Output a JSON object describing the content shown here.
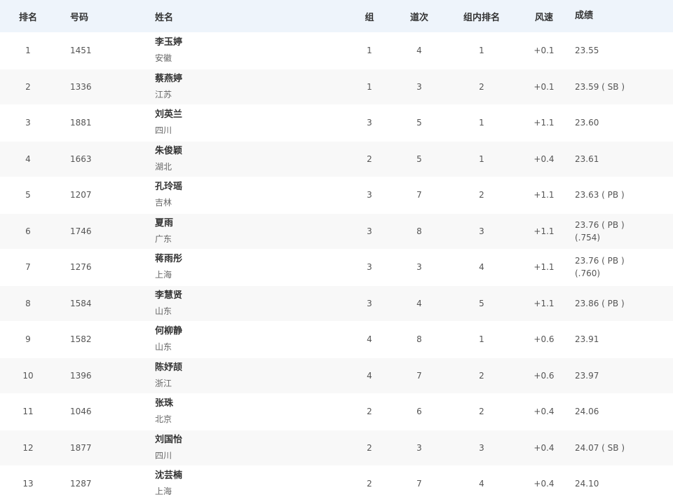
{
  "headers": {
    "rank": "排名",
    "bib": "号码",
    "name": "姓名",
    "group": "组",
    "lane": "道次",
    "group_rank": "组内排名",
    "wind": "风速",
    "result": "成绩"
  },
  "rows": [
    {
      "rank": "1",
      "bib": "1451",
      "name": "李玉婷",
      "team": "安徽",
      "group": "1",
      "lane": "4",
      "group_rank": "1",
      "wind": "+0.1",
      "result": "23.55",
      "note": ""
    },
    {
      "rank": "2",
      "bib": "1336",
      "name": "蔡燕婷",
      "team": "江苏",
      "group": "1",
      "lane": "3",
      "group_rank": "2",
      "wind": "+0.1",
      "result": "23.59 ( SB )",
      "note": ""
    },
    {
      "rank": "3",
      "bib": "1881",
      "name": "刘英兰",
      "team": "四川",
      "group": "3",
      "lane": "5",
      "group_rank": "1",
      "wind": "+1.1",
      "result": "23.60",
      "note": ""
    },
    {
      "rank": "4",
      "bib": "1663",
      "name": "朱俊颖",
      "team": "湖北",
      "group": "2",
      "lane": "5",
      "group_rank": "1",
      "wind": "+0.4",
      "result": "23.61",
      "note": ""
    },
    {
      "rank": "5",
      "bib": "1207",
      "name": "孔玲瑶",
      "team": "吉林",
      "group": "3",
      "lane": "7",
      "group_rank": "2",
      "wind": "+1.1",
      "result": "23.63 ( PB )",
      "note": ""
    },
    {
      "rank": "6",
      "bib": "1746",
      "name": "夏雨",
      "team": "广东",
      "group": "3",
      "lane": "8",
      "group_rank": "3",
      "wind": "+1.1",
      "result": "23.76 ( PB )",
      "note": "(.754)"
    },
    {
      "rank": "7",
      "bib": "1276",
      "name": "蒋雨彤",
      "team": "上海",
      "group": "3",
      "lane": "3",
      "group_rank": "4",
      "wind": "+1.1",
      "result": "23.76 ( PB )",
      "note": "(.760)"
    },
    {
      "rank": "8",
      "bib": "1584",
      "name": "李慧贤",
      "team": "山东",
      "group": "3",
      "lane": "4",
      "group_rank": "5",
      "wind": "+1.1",
      "result": "23.86 ( PB )",
      "note": ""
    },
    {
      "rank": "9",
      "bib": "1582",
      "name": "何柳静",
      "team": "山东",
      "group": "4",
      "lane": "8",
      "group_rank": "1",
      "wind": "+0.6",
      "result": "23.91",
      "note": ""
    },
    {
      "rank": "10",
      "bib": "1396",
      "name": "陈妤颉",
      "team": "浙江",
      "group": "4",
      "lane": "7",
      "group_rank": "2",
      "wind": "+0.6",
      "result": "23.97",
      "note": ""
    },
    {
      "rank": "11",
      "bib": "1046",
      "name": "张珠",
      "team": "北京",
      "group": "2",
      "lane": "6",
      "group_rank": "2",
      "wind": "+0.4",
      "result": "24.06",
      "note": ""
    },
    {
      "rank": "12",
      "bib": "1877",
      "name": "刘国怡",
      "team": "四川",
      "group": "2",
      "lane": "3",
      "group_rank": "3",
      "wind": "+0.4",
      "result": "24.07 ( SB )",
      "note": ""
    },
    {
      "rank": "13",
      "bib": "1287",
      "name": "沈芸楠",
      "team": "上海",
      "group": "2",
      "lane": "7",
      "group_rank": "4",
      "wind": "+0.4",
      "result": "24.10",
      "note": ""
    }
  ]
}
